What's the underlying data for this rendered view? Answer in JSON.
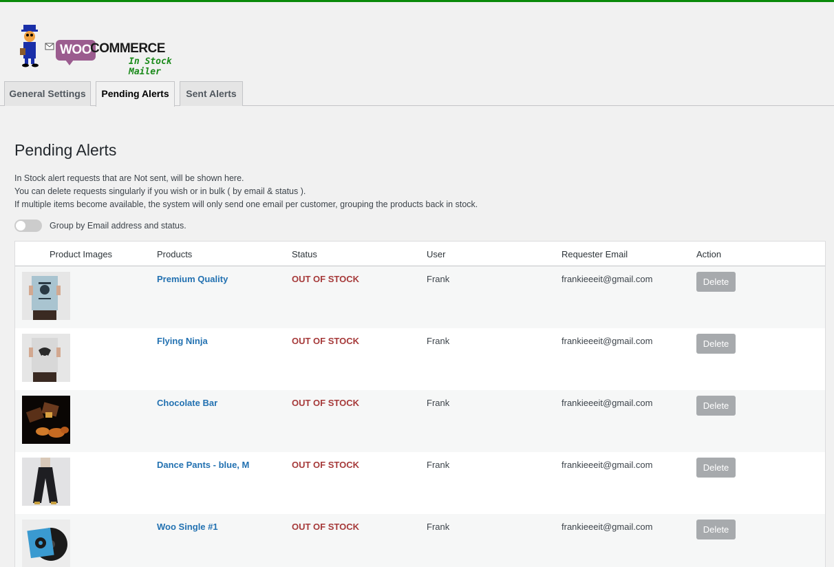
{
  "logo": {
    "woo": "WOO",
    "commerce": "COMMERCE",
    "subtitle": "In Stock Mailer"
  },
  "tabs": [
    {
      "label": "General Settings",
      "active": false
    },
    {
      "label": "Pending Alerts",
      "active": true
    },
    {
      "label": "Sent Alerts",
      "active": false
    }
  ],
  "page": {
    "title": "Pending Alerts",
    "description": [
      "In Stock alert requests that are Not sent, will be shown here.",
      "You can delete requests singularly if you wish or in bulk ( by email & status ).",
      "If multiple items become available, the system will only send one email per customer, grouping the products back in stock."
    ],
    "group_toggle_label": "Group by Email address and status.",
    "group_toggle_on": false
  },
  "table": {
    "headers": [
      "Product Images",
      "Products",
      "Status",
      "User",
      "Requester Email",
      "Action"
    ],
    "rows": [
      {
        "product": "Premium Quality",
        "status": "OUT OF STOCK",
        "user": "Frank",
        "email": "frankieeeit@gmail.com",
        "action": "Delete",
        "image": "poster-icon"
      },
      {
        "product": "Flying Ninja",
        "status": "OUT OF STOCK",
        "user": "Frank",
        "email": "frankieeeit@gmail.com",
        "action": "Delete",
        "image": "poster-icon"
      },
      {
        "product": "Chocolate Bar",
        "status": "OUT OF STOCK",
        "user": "Frank",
        "email": "frankieeeit@gmail.com",
        "action": "Delete",
        "image": "chocolate-icon"
      },
      {
        "product": "Dance Pants - blue, M",
        "status": "OUT OF STOCK",
        "user": "Frank",
        "email": "frankieeeit@gmail.com",
        "action": "Delete",
        "image": "pants-icon"
      },
      {
        "product": "Woo Single #1",
        "status": "OUT OF STOCK",
        "user": "Frank",
        "email": "frankieeeit@gmail.com",
        "action": "Delete",
        "image": "vinyl-icon"
      }
    ]
  },
  "colors": {
    "top_bar": "#0a8a0a",
    "link": "#2271b1",
    "status_out_of_stock": "#a63a3a",
    "delete_button": "#a7aaad",
    "woo_brand": "#9b5c8f"
  }
}
